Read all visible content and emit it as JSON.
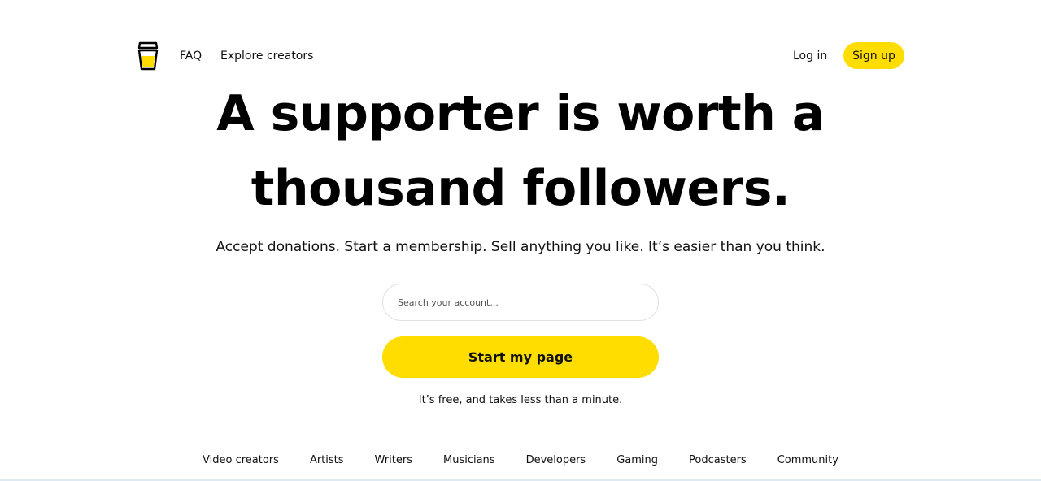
{
  "header": {
    "logo_icon": "coffee-cup-icon",
    "nav": {
      "faq": "FAQ",
      "explore": "Explore creators"
    },
    "login": "Log in",
    "signup": "Sign up"
  },
  "hero": {
    "title_line1": "A supporter is worth a",
    "title_line2": "thousand followers.",
    "subtitle": "Accept donations. Start a membership. Sell anything you like. It’s easier than you think."
  },
  "search": {
    "placeholder": "Search your account...",
    "value": ""
  },
  "cta": {
    "label": "Start my page",
    "note": "It’s free, and takes less than a minute."
  },
  "categories": [
    "Video creators",
    "Artists",
    "Writers",
    "Musicians",
    "Developers",
    "Gaming",
    "Podcasters",
    "Community"
  ],
  "colors": {
    "accent": "#ffdd00",
    "text": "#000000",
    "background": "#ffffff"
  }
}
